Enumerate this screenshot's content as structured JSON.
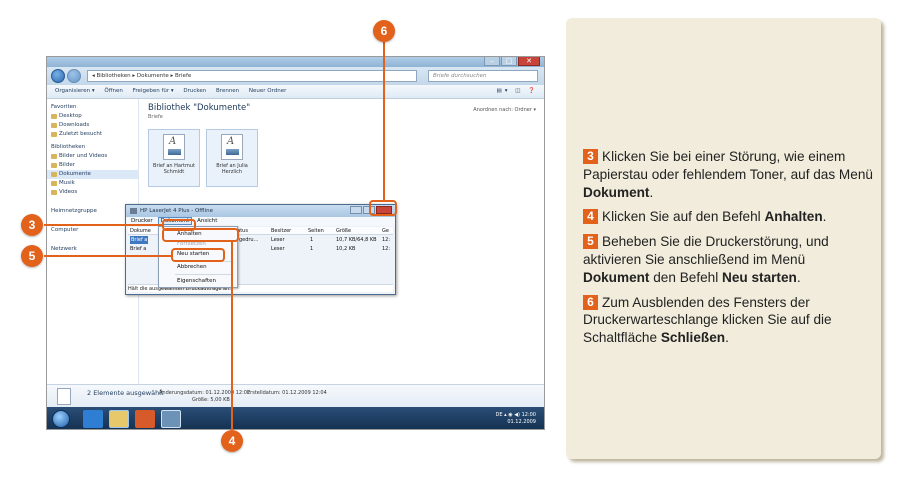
{
  "explorer": {
    "address_path": "◂ Bibliotheken ▸ Dokumente ▸ Briefe",
    "search_placeholder": "Briefe durchsuchen",
    "toolbar": [
      "Organisieren ▾",
      "Öffnen",
      "Freigeben für ▾",
      "Drucken",
      "Brennen",
      "Neuer Ordner"
    ],
    "nav": [
      {
        "label": "Favoriten",
        "type": "h"
      },
      {
        "label": "Desktop"
      },
      {
        "label": "Downloads"
      },
      {
        "label": "Zuletzt besucht"
      },
      {
        "label": "Bibliotheken",
        "type": "h"
      },
      {
        "label": "Bilder und Videos"
      },
      {
        "label": "Bilder"
      },
      {
        "label": "Dokumente",
        "selected": true
      },
      {
        "label": "Musik"
      },
      {
        "label": "Videos"
      },
      {
        "label": "Heimnetzgruppe",
        "type": "h"
      },
      {
        "label": "Computer",
        "type": "h"
      },
      {
        "label": "Netzwerk",
        "type": "h"
      }
    ],
    "library_title": "Bibliothek \"Dokumente\"",
    "library_sub": "Briefe",
    "arrange_label": "Anordnen nach:  Ordner ▾",
    "files": [
      "Brief an Hartmut Schmidt",
      "Brief an Julia Herzlich"
    ],
    "details": {
      "selected": "2 Elemente ausgewählt",
      "changed": "Änderungsdatum: 01.12.2009 12:02",
      "size": "Größe: 5,00 KB",
      "created": "Erstelldatum: 01.12.2009 12:04"
    },
    "tray": {
      "lang": "DE",
      "time": "12:00",
      "date": "01.12.2009"
    }
  },
  "printer": {
    "title": "HP LaserJet 4 Plus - Offline",
    "menu": [
      "Drucker",
      "Dokument",
      "Ansicht"
    ],
    "columns": [
      "Dokume",
      "Status",
      "Besitzer",
      "Seiten",
      "Größe",
      "Ge"
    ],
    "rows": [
      [
        "Brief a",
        "Wird gedru...",
        "Leser",
        "1",
        "10,7 KB/64,8 KB",
        "12:"
      ],
      [
        "Brief a",
        "",
        "Leser",
        "1",
        "10,2 KB",
        "12:"
      ]
    ],
    "dropdown": [
      "Anhalten",
      "Fortsetzen",
      "Neu starten",
      "Abbrechen",
      "Eigenschaften"
    ],
    "status": "Hält die ausgewählten Druckaufträge an."
  },
  "callouts": [
    "3",
    "4",
    "5",
    "6"
  ],
  "steps": [
    {
      "num": "3",
      "parts": [
        {
          "t": "Klicken Sie bei einer Störung, wie einem Papierstau oder fehlendem Toner, auf das Menü "
        },
        {
          "t": "Dokument",
          "b": true
        },
        {
          "t": "."
        }
      ]
    },
    {
      "num": "4",
      "parts": [
        {
          "t": "Klicken Sie auf den Befehl "
        },
        {
          "t": "Anhalten",
          "b": true
        },
        {
          "t": "."
        }
      ]
    },
    {
      "num": "5",
      "parts": [
        {
          "t": "Beheben Sie die Druckerstörung, und aktivieren Sie anschließend im Menü "
        },
        {
          "t": "Dokument",
          "b": true
        },
        {
          "t": " den Befehl "
        },
        {
          "t": "Neu starten",
          "b": true
        },
        {
          "t": "."
        }
      ]
    },
    {
      "num": "6",
      "parts": [
        {
          "t": "Zum Ausblenden des Fensters der Druckerwarteschlange klicken Sie auf die Schaltfläche "
        },
        {
          "t": "Schließen",
          "b": true
        },
        {
          "t": "."
        }
      ]
    }
  ]
}
